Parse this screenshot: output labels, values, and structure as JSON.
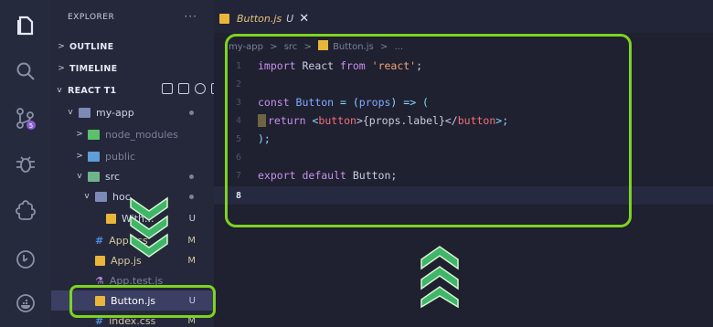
{
  "sidebar": {
    "header": "EXPLORER",
    "more": "···",
    "sections": {
      "outline": "OUTLINE",
      "timeline": "TIMELINE",
      "project": "REACT T1"
    },
    "tree": {
      "my_app": "my-app",
      "node_modules": "node_modules",
      "public": "public",
      "src": "src",
      "hoc": "hoc",
      "hoc_file": "With...",
      "app_css": "App.css",
      "app_js": "App.js",
      "app_test": "App.test.js",
      "button_js": "Button.js",
      "index_css": "index.css"
    },
    "badges": {
      "u": "U",
      "m": "M"
    }
  },
  "tab": {
    "title": "Button.js",
    "status": "U",
    "close": "✕"
  },
  "breadcrumbs": [
    "my-app",
    ">",
    "src",
    ">",
    "Button.js",
    ">",
    "..."
  ],
  "code": {
    "line_numbers": [
      "1",
      "2",
      "3",
      "4",
      "5",
      "6",
      "7",
      "8"
    ],
    "l1_kw": "import",
    "l1_name": " React ",
    "l1_from": "from",
    "l1_str": " 'react'",
    "l1_end": ";",
    "l3_kw": "const",
    "l3_name": " Button ",
    "l3_op": "= (",
    "l3_param": "props",
    "l3_arrow": ") => (",
    "l4_kw": "return",
    "l4_open": " <",
    "l4_tag": "button",
    "l4_mid": ">{props.label}</",
    "l4_tag2": "button",
    "l4_close": ">;",
    "l5": ");",
    "l7_kw": "export",
    "l7_def": " default",
    "l7_name": " Button;"
  },
  "colors": {
    "highlight": "#7ed321",
    "arrows": "#3fb66a"
  }
}
